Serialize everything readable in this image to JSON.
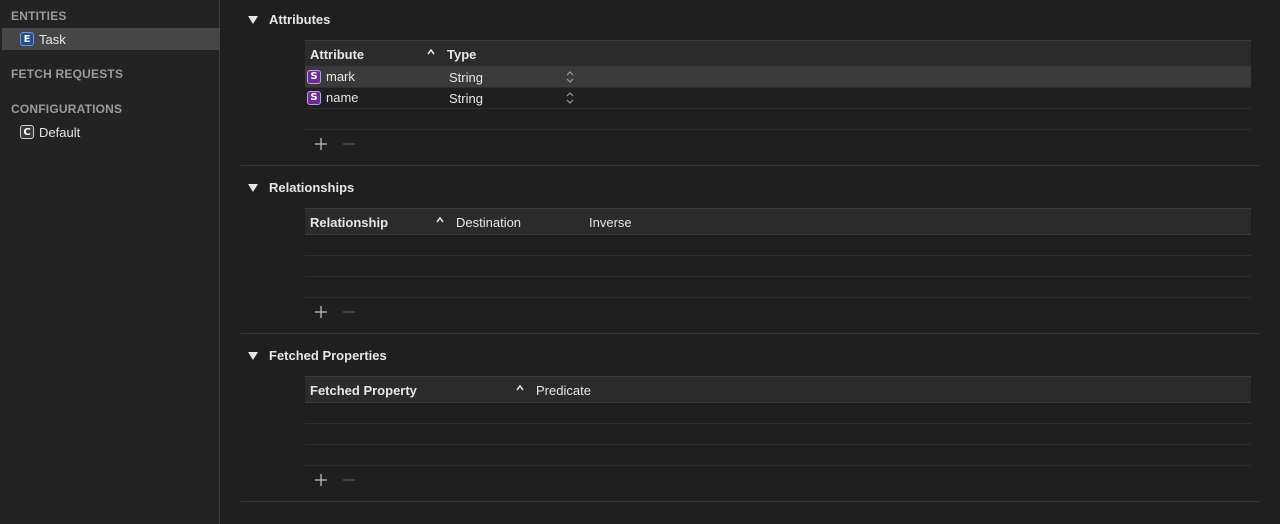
{
  "sidebar": {
    "entities_header": "ENTITIES",
    "entities": [
      {
        "badge": "E",
        "label": "Task"
      }
    ],
    "fetch_requests_header": "FETCH REQUESTS",
    "configurations_header": "CONFIGURATIONS",
    "configurations": [
      {
        "badge": "C",
        "label": "Default"
      }
    ]
  },
  "attributes": {
    "title": "Attributes",
    "columns": [
      "Attribute",
      "Type"
    ],
    "rows": [
      {
        "badge": "S",
        "name": "mark",
        "type": "String"
      },
      {
        "badge": "S",
        "name": "name",
        "type": "String"
      }
    ]
  },
  "relationships": {
    "title": "Relationships",
    "columns": [
      "Relationship",
      "Destination",
      "Inverse"
    ]
  },
  "fetched_properties": {
    "title": "Fetched Properties",
    "columns": [
      "Fetched Property",
      "Predicate"
    ]
  },
  "icons": {
    "disclosure": "disclosure-triangle-down-icon",
    "sort": "sort-ascending-caret-icon",
    "stepper": "popup-stepper-icon",
    "add": "plus-icon",
    "remove": "minus-icon"
  }
}
